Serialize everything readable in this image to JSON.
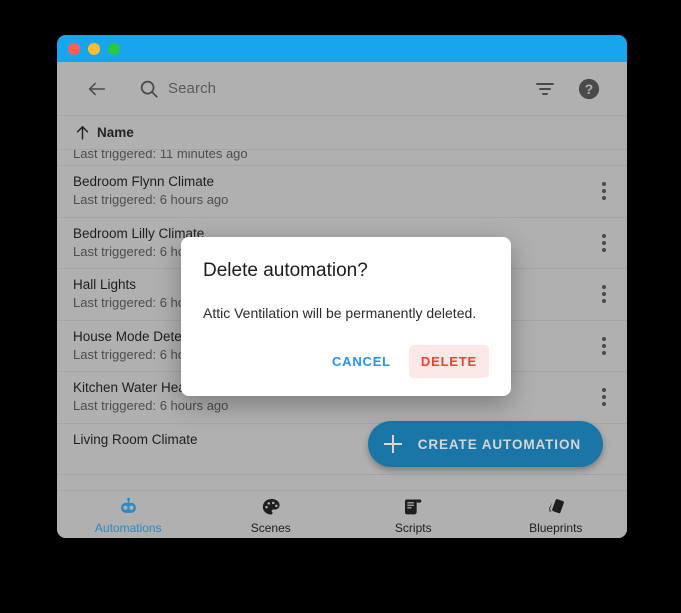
{
  "window": {
    "titlebar_color": "#17a6ee",
    "traffic_lights": [
      "close",
      "minimize",
      "maximize"
    ]
  },
  "toolbar": {
    "back_icon": "arrow-left-icon",
    "search_icon": "search-icon",
    "search_placeholder": "Search",
    "search_value": "",
    "filter_icon": "filter-icon",
    "help_icon": "help-circle-icon"
  },
  "sort_header": {
    "arrow_icon": "arrow-up-icon",
    "label": "Name",
    "direction": "ascending"
  },
  "list": {
    "subtitle_prefix": "Last triggered:",
    "rows": [
      {
        "title": "",
        "subtitle": "Last triggered: 11 minutes ago",
        "partial": true
      },
      {
        "title": "Bedroom Flynn Climate",
        "subtitle": "Last triggered: 6 hours ago",
        "partial": false
      },
      {
        "title": "Bedroom Lilly Climate",
        "subtitle": "Last triggered: 6 hours ago",
        "partial": false
      },
      {
        "title": "Hall Lights",
        "subtitle": "Last triggered: 6 hours ago",
        "partial": false
      },
      {
        "title": "House Mode Detection",
        "subtitle": "Last triggered: 6 hours ago",
        "partial": false
      },
      {
        "title": "Kitchen Water Heater",
        "subtitle": "Last triggered: 6 hours ago",
        "partial": false
      },
      {
        "title": "Living Room Climate",
        "subtitle": "",
        "partial": false
      }
    ],
    "overflow_icon": "more-vertical-icon"
  },
  "fab": {
    "icon": "plus-icon",
    "label": "CREATE AUTOMATION",
    "color": "#1b76a8"
  },
  "bottom_nav": {
    "active_color": "#2a89c8",
    "items": [
      {
        "label": "Automations",
        "icon": "robot-icon",
        "active": true
      },
      {
        "label": "Scenes",
        "icon": "palette-icon",
        "active": false
      },
      {
        "label": "Scripts",
        "icon": "scroll-icon",
        "active": false
      },
      {
        "label": "Blueprints",
        "icon": "blueprint-cards-icon",
        "active": false
      }
    ]
  },
  "dialog": {
    "title": "Delete automation?",
    "message": "Attic Ventilation will be permanently deleted.",
    "cancel_label": "CANCEL",
    "delete_label": "DELETE",
    "cancel_color": "#2196f3",
    "delete_color": "#ea4335",
    "delete_background": "#fce9e7"
  }
}
